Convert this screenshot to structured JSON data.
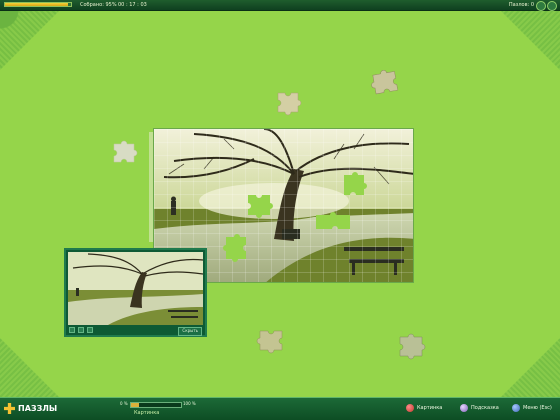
{
  "top_bar": {
    "progress_fraction": 0.95,
    "collected_label": "Собрано: 95%",
    "timer": "00 : 17 : 03",
    "pieces_label": "Пазлов: 0"
  },
  "preview": {
    "hide_button": "Скрыть"
  },
  "bottom_bar": {
    "logo_text": "ПАЗЗЛЫ",
    "slider_min": "0 %",
    "slider_max": "100 %",
    "slider_fraction": 0.15,
    "picture_label": "Картинка",
    "buttons": [
      {
        "label": "Картинка",
        "icon": "picture-icon"
      },
      {
        "label": "Подсказка",
        "icon": "hint-icon"
      },
      {
        "label": "Меню (Esc)",
        "icon": "menu-icon"
      }
    ]
  },
  "colors": {
    "background": "#95d54a",
    "bar": "#0f4a24",
    "accent": "#f4c232"
  }
}
